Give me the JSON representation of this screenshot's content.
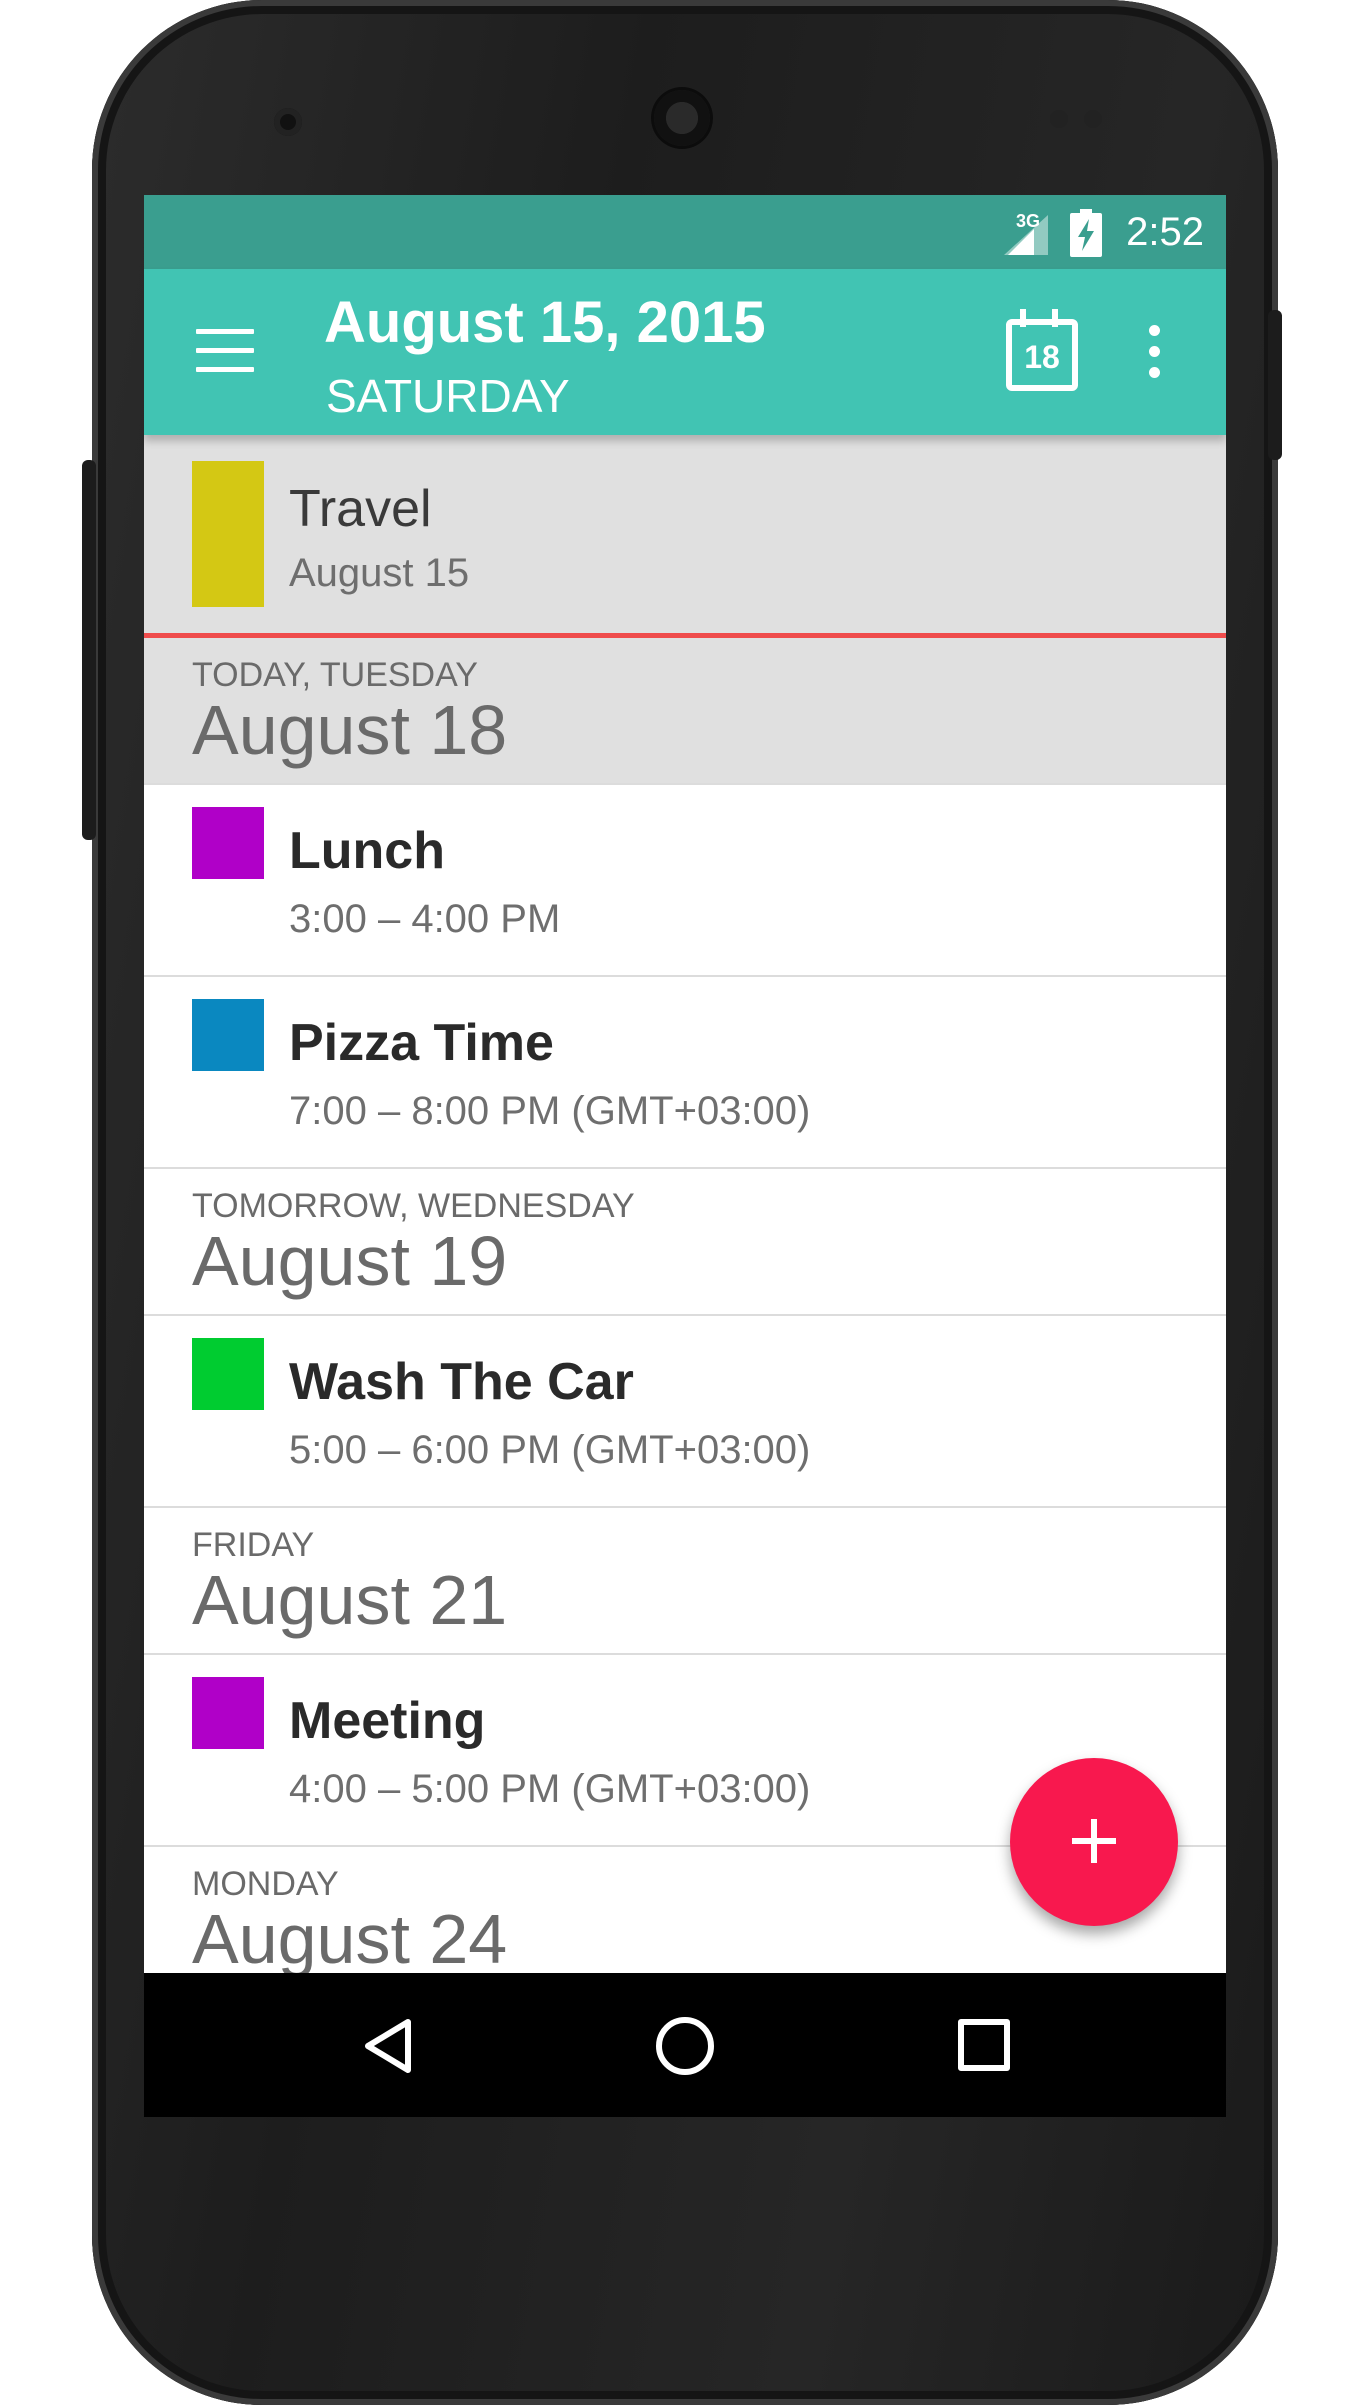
{
  "status_bar": {
    "network": "3G",
    "time": "2:52"
  },
  "app_bar": {
    "title": "August 15, 2015",
    "subtitle": "SATURDAY",
    "calendar_day": "18",
    "color": "#41c4b3"
  },
  "past_event": {
    "title": "Travel",
    "date": "August 15",
    "color": "#d4c814"
  },
  "sections": [
    {
      "label": "TODAY, TUESDAY",
      "date": "August 18",
      "events": [
        {
          "title": "Lunch",
          "time": "3:00 – 4:00 PM",
          "color": "#b000c8"
        },
        {
          "title": "Pizza Time",
          "time": "7:00 – 8:00 PM (GMT+03:00)",
          "color": "#0a88c0"
        }
      ]
    },
    {
      "label": "TOMORROW, WEDNESDAY",
      "date": "August 19",
      "events": [
        {
          "title": "Wash The Car",
          "time": "5:00 – 6:00 PM (GMT+03:00)",
          "color": "#00cc30"
        }
      ]
    },
    {
      "label": "FRIDAY",
      "date": "August 21",
      "events": [
        {
          "title": "Meeting",
          "time": "4:00 – 5:00 PM (GMT+03:00)",
          "color": "#b000c8"
        }
      ]
    },
    {
      "label": "MONDAY",
      "date": "August 24",
      "events": []
    }
  ],
  "fab": {
    "icon": "plus-icon",
    "color": "#f8184e"
  },
  "nav_bar": {
    "icons": [
      "back-icon",
      "home-icon",
      "recents-icon"
    ]
  }
}
